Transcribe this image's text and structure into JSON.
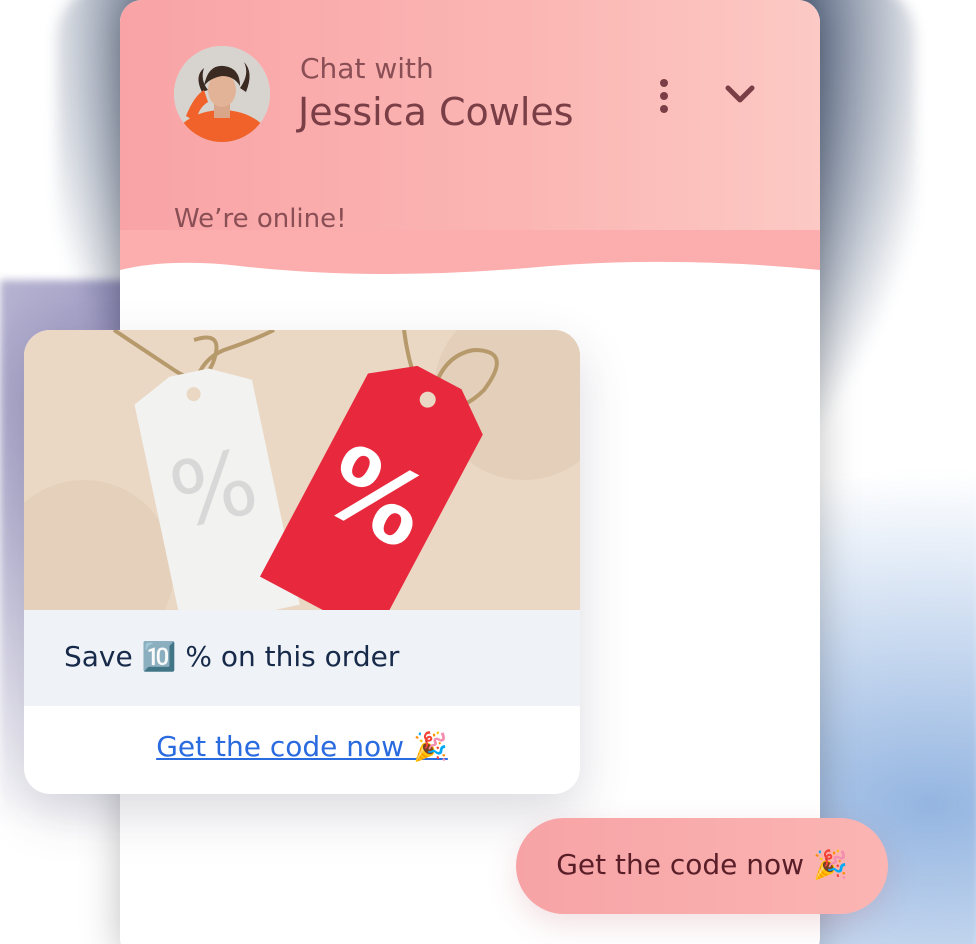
{
  "header": {
    "subtitle": "Chat with",
    "agent_name": "Jessica Cowles",
    "status": "We’re online!"
  },
  "offer_card": {
    "caption": "Save 🔟 % on this order",
    "link_label": "Get the code now 🎉"
  },
  "user_reply": {
    "text": "Get the code now 🎉"
  },
  "icons": [
    "menu-dots-icon",
    "chevron-down-icon",
    "agent-avatar"
  ],
  "colors": {
    "header_bg": "#f9a3a6",
    "link": "#2b6be0",
    "tag_red": "#e8283c"
  }
}
